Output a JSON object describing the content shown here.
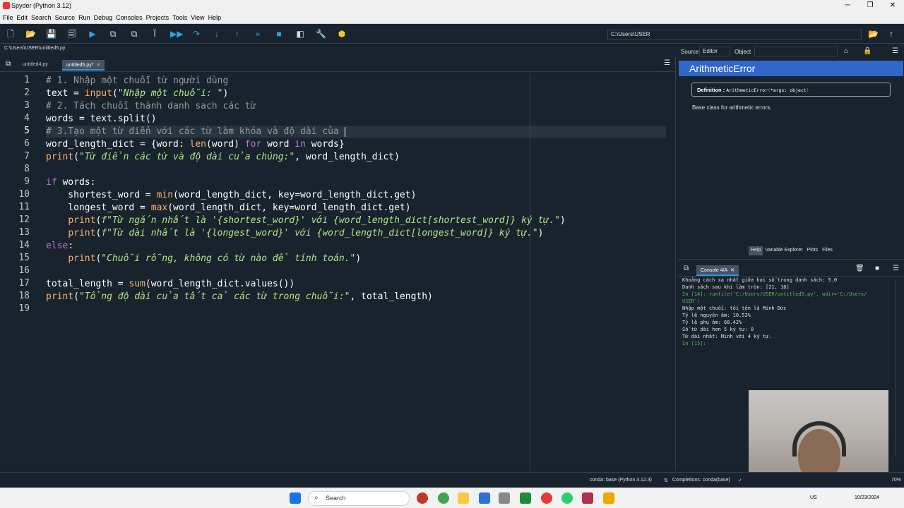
{
  "window": {
    "title": "Spyder (Python 3.12)",
    "min": "─",
    "max": "❐",
    "close": "✕"
  },
  "menu": [
    "File",
    "Edit",
    "Search",
    "Source",
    "Run",
    "Debug",
    "Consoles",
    "Projects",
    "Tools",
    "View",
    "Help"
  ],
  "toolbar": {
    "path": "C:\\Users\\USER"
  },
  "editor": {
    "file_path": "C:\\Users\\USER\\untitled5.py",
    "tabs": [
      {
        "label": "untitled4.py"
      },
      {
        "label": "untitled5.py*"
      }
    ],
    "line_numbers": [
      "1",
      "2",
      "3",
      "4",
      "5",
      "6",
      "7",
      "8",
      "9",
      "10",
      "11",
      "12",
      "13",
      "14",
      "15",
      "16",
      "17",
      "18",
      "19"
    ],
    "code": {
      "l1": "# 1. Nhập một chuỗi từ người dùng",
      "l2a": "text = ",
      "l2b": "input",
      "l2c": "(",
      "l2d": "\"Nhập một chuỗi: \"",
      "l2e": ")",
      "l3": "# 2. Tách chuỗi thành danh sach các từ",
      "l4": "words = text.split()",
      "l5": "# 3.Tạo một từ điển với các từ làm khóa và độ dài của ",
      "l6a": "word_length_dict = {word: ",
      "l6b": "len",
      "l6c": "(word) ",
      "l6d": "for",
      "l6e": " word ",
      "l6f": "in",
      "l6g": " words}",
      "l7a": "print",
      "l7b": "(",
      "l7c": "\"Từ điển các từ và độ dài của chúng:\"",
      "l7d": ", word_length_dict)",
      "l9a": "if",
      "l9b": " words:",
      "l10a": "    shortest_word = ",
      "l10b": "min",
      "l10c": "(word_length_dict, key=word_length_dict.get)",
      "l11a": "    longest_word = ",
      "l11b": "max",
      "l11c": "(word_length_dict, key=word_length_dict.get)",
      "l12a": "    ",
      "l12b": "print",
      "l12c": "(",
      "l12d": "f\"Từ ngắn nhất là '{shortest_word}' với {word_length_dict[shortest_word]} ký tự.\"",
      "l12e": ")",
      "l13a": "    ",
      "l13b": "print",
      "l13c": "(",
      "l13d": "f\"Từ dài nhất là '{longest_word}' với {word_length_dict[longest_word]} ký tự.\"",
      "l13e": ")",
      "l14a": "else",
      "l14b": ":",
      "l15a": "    ",
      "l15b": "print",
      "l15c": "(",
      "l15d": "\"Chuỗi rỗng, không có từ nào để tính toán.\"",
      "l15e": ")",
      "l17a": "total_length = ",
      "l17b": "sum",
      "l17c": "(word_length_dict.values())",
      "l18a": "print",
      "l18b": "(",
      "l18c": "\"Tổng độ dài của tất cả các từ trong chuỗi:\"",
      "l18d": ", total_length)"
    }
  },
  "help": {
    "source_label": "Source",
    "source_value": "Editor",
    "object_label": "Object",
    "title": "ArithmeticError",
    "def_key": "Definition : ",
    "def_name": "ArithmeticError",
    "def_open": "(",
    "def_args": "*args: object",
    "def_close": ")",
    "description": "Base class for arithmetic errors.",
    "pane_tabs": [
      "Help",
      "Variable Explorer",
      "Plots",
      "Files"
    ]
  },
  "console": {
    "tab": "Console 4/A",
    "lines": [
      "Khoảng cách xa nhất giữa hai số trong danh sách: 5.0",
      "Danh sách sau khi làm tròn: [21, 16]",
      "",
      "In [14]: runfile('C:/Users/USER/untitled5.py', wdir='C:/Users/",
      "USER')",
      "Nhập một chuỗi: tôi tên là Minh Đức",
      "Tỷ lệ nguyên âm: 10.53%",
      "Tỷ lệ phụ âm: 68.42%",
      "Số từ dài hơn 5 ký tự: 0",
      "Từ dài nhất: Minh với 4 ký tự.",
      "",
      "In [15]:"
    ]
  },
  "status": {
    "conda": "conda: base (Python 3.12.3)",
    "completions": "Completions: conda(base)",
    "zoom": "70%"
  },
  "taskbar": {
    "search": "Search",
    "lang": "US",
    "date": "10/23/2024"
  }
}
